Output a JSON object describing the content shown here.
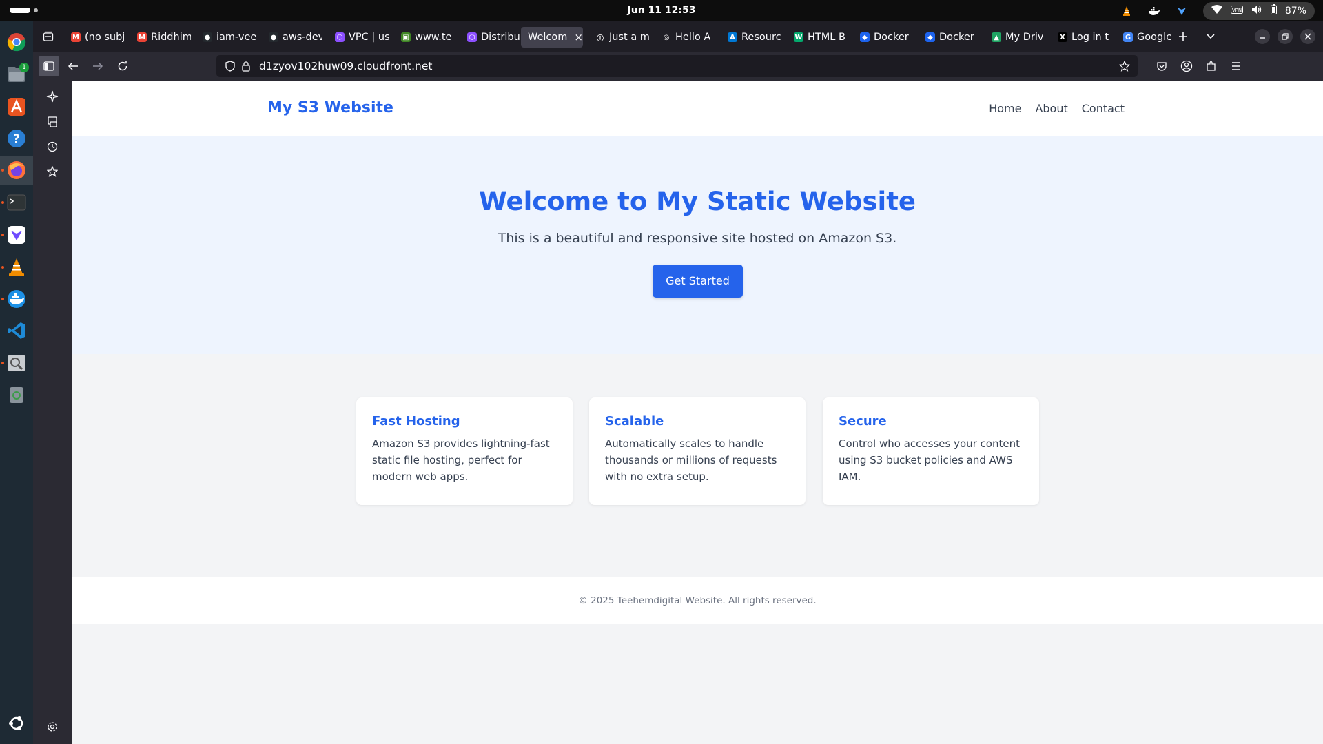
{
  "system": {
    "clock": "Jun 11  12:53",
    "battery": "87%"
  },
  "browser": {
    "tabs": [
      {
        "label": "(no subj",
        "icon": "gmail-icon"
      },
      {
        "label": "Riddhim",
        "icon": "gmail-icon"
      },
      {
        "label": "iam-vee",
        "icon": "github-icon"
      },
      {
        "label": "aws-dev",
        "icon": "github-icon"
      },
      {
        "label": "VPC | us",
        "icon": "aws-vpc-icon"
      },
      {
        "label": "www.te",
        "icon": "aws-s3-icon"
      },
      {
        "label": "Distribu",
        "icon": "aws-cloudfront-icon"
      },
      {
        "label": "Welcome",
        "icon": "none",
        "active": true
      },
      {
        "label": "Just a m",
        "icon": "info-icon"
      },
      {
        "label": "Hello A",
        "icon": "globe-icon"
      },
      {
        "label": "Resourc",
        "icon": "azure-icon"
      },
      {
        "label": "HTML B",
        "icon": "w3-icon"
      },
      {
        "label": "Docker",
        "icon": "docker-icon"
      },
      {
        "label": "Docker",
        "icon": "docker-icon"
      },
      {
        "label": "My Driv",
        "icon": "drive-icon"
      },
      {
        "label": "Log in t",
        "icon": "x-icon"
      },
      {
        "label": "Google",
        "icon": "google-icon"
      }
    ],
    "url": "d1zyov102huw09.cloudfront.net"
  },
  "site": {
    "logo": "My S3 Website",
    "nav": [
      "Home",
      "About",
      "Contact"
    ],
    "hero": {
      "title": "Welcome to My Static Website",
      "subtitle": "This is a beautiful and responsive site hosted on Amazon S3.",
      "cta": "Get Started"
    },
    "features": [
      {
        "title": "Fast Hosting",
        "text": "Amazon S3 provides lightning-fast static file hosting, perfect for modern web apps."
      },
      {
        "title": "Scalable",
        "text": "Automatically scales to handle thousands or millions of requests with no extra setup."
      },
      {
        "title": "Secure",
        "text": "Control who accesses your content using S3 bucket policies and AWS IAM."
      }
    ],
    "footer": "© 2025 Teehemdigital Website. All rights reserved."
  },
  "colors": {
    "brand": "#2563eb",
    "hero_bg": "#eef4fe",
    "page_bg": "#f3f4f6"
  }
}
